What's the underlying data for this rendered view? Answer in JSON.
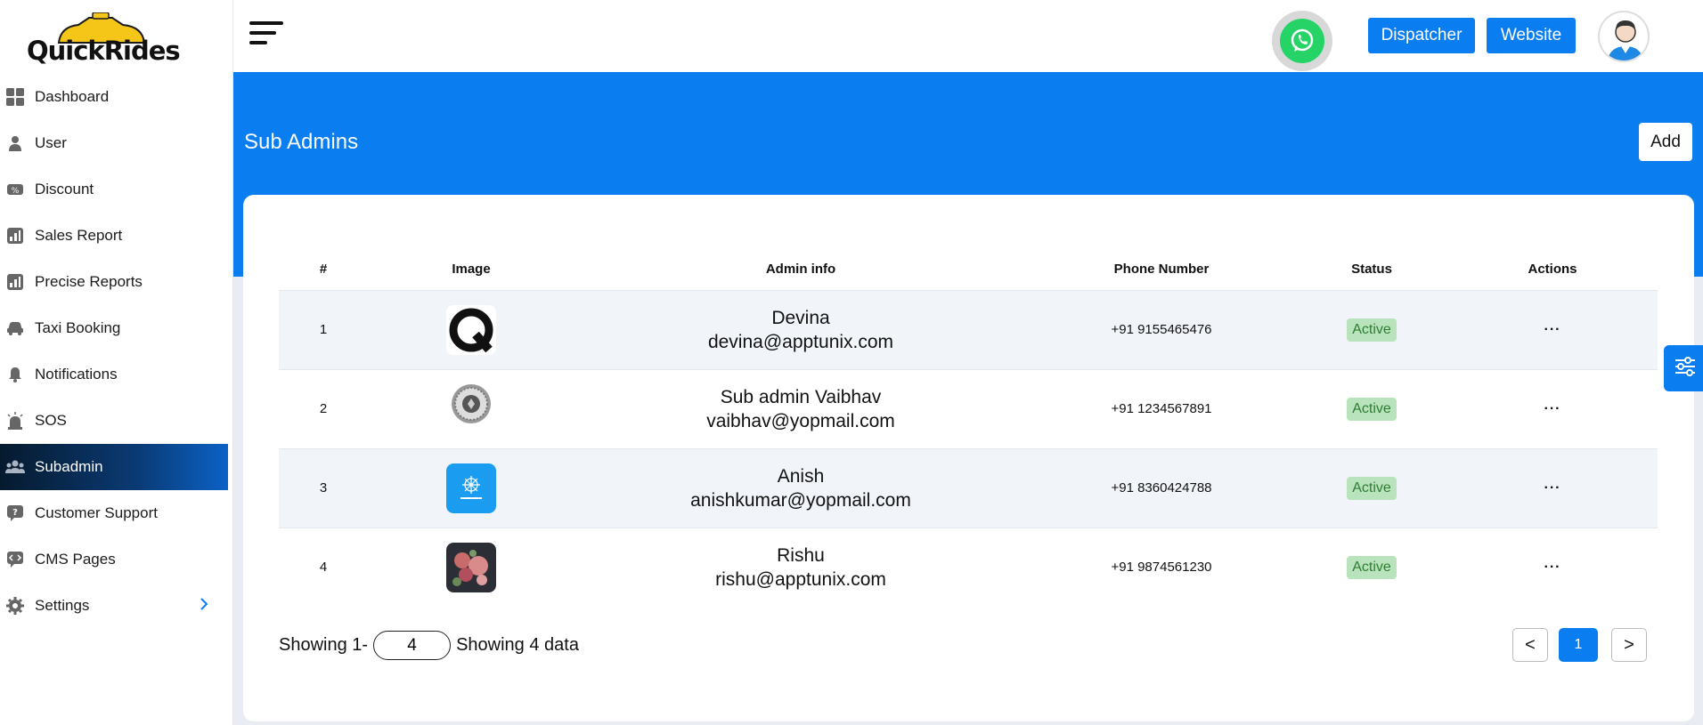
{
  "brand": {
    "name": "QuickRides"
  },
  "sidebar": {
    "items": [
      {
        "label": "Dashboard",
        "icon": "dashboard-icon"
      },
      {
        "label": "User",
        "icon": "user-icon"
      },
      {
        "label": "Discount",
        "icon": "discount-icon"
      },
      {
        "label": "Sales Report",
        "icon": "report-icon"
      },
      {
        "label": "Precise Reports",
        "icon": "report-icon"
      },
      {
        "label": "Taxi Booking",
        "icon": "taxi-icon"
      },
      {
        "label": "Notifications",
        "icon": "bell-icon"
      },
      {
        "label": "SOS",
        "icon": "alarm-icon"
      },
      {
        "label": "Subadmin",
        "icon": "group-icon",
        "active": true
      },
      {
        "label": "Customer Support",
        "icon": "support-icon"
      },
      {
        "label": "CMS Pages",
        "icon": "code-icon"
      },
      {
        "label": "Settings",
        "icon": "gear-icon"
      }
    ]
  },
  "topbar": {
    "dispatcher_label": "Dispatcher",
    "website_label": "Website"
  },
  "page": {
    "title": "Sub Admins",
    "add_label": "Add"
  },
  "table": {
    "headers": {
      "num": "#",
      "image": "Image",
      "admin_info": "Admin info",
      "phone": "Phone Number",
      "status": "Status",
      "actions": "Actions"
    },
    "rows": [
      {
        "num": "1",
        "name": "Devina",
        "email": "devina@apptunix.com",
        "phone": "+91 9155465476",
        "status": "Active",
        "actions": "···"
      },
      {
        "num": "2",
        "name": "Sub admin Vaibhav",
        "email": "vaibhav@yopmail.com",
        "phone": "+91 1234567891",
        "status": "Active",
        "actions": "···"
      },
      {
        "num": "3",
        "name": "Anish",
        "email": "anishkumar@yopmail.com",
        "phone": "+91 8360424788",
        "status": "Active",
        "actions": "···"
      },
      {
        "num": "4",
        "name": "Rishu",
        "email": "rishu@apptunix.com",
        "phone": "+91 9874561230",
        "status": "Active",
        "actions": "···"
      }
    ]
  },
  "footer": {
    "showing_prefix": "Showing 1-",
    "page_size": "4",
    "showing_suffix": "Showing 4 data",
    "prev": "<",
    "current_page": "1",
    "next": ">"
  },
  "colors": {
    "primary": "#0a7df0",
    "active_badge_bg": "#b9e3bd",
    "active_badge_text": "#2e7d32",
    "whatsapp": "#25d366"
  }
}
